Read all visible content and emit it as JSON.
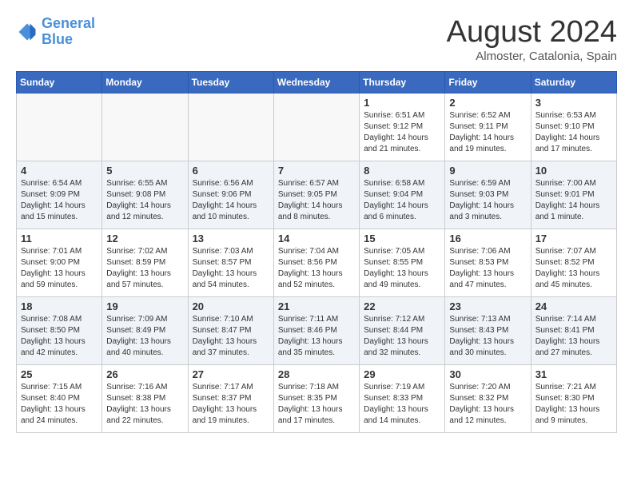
{
  "header": {
    "logo": {
      "line1": "General",
      "line2": "Blue"
    },
    "title": "August 2024",
    "location": "Almoster, Catalonia, Spain"
  },
  "weekdays": [
    "Sunday",
    "Monday",
    "Tuesday",
    "Wednesday",
    "Thursday",
    "Friday",
    "Saturday"
  ],
  "weeks": [
    [
      {
        "day": "",
        "text": ""
      },
      {
        "day": "",
        "text": ""
      },
      {
        "day": "",
        "text": ""
      },
      {
        "day": "",
        "text": ""
      },
      {
        "day": "1",
        "text": "Sunrise: 6:51 AM\nSunset: 9:12 PM\nDaylight: 14 hours\nand 21 minutes."
      },
      {
        "day": "2",
        "text": "Sunrise: 6:52 AM\nSunset: 9:11 PM\nDaylight: 14 hours\nand 19 minutes."
      },
      {
        "day": "3",
        "text": "Sunrise: 6:53 AM\nSunset: 9:10 PM\nDaylight: 14 hours\nand 17 minutes."
      }
    ],
    [
      {
        "day": "4",
        "text": "Sunrise: 6:54 AM\nSunset: 9:09 PM\nDaylight: 14 hours\nand 15 minutes."
      },
      {
        "day": "5",
        "text": "Sunrise: 6:55 AM\nSunset: 9:08 PM\nDaylight: 14 hours\nand 12 minutes."
      },
      {
        "day": "6",
        "text": "Sunrise: 6:56 AM\nSunset: 9:06 PM\nDaylight: 14 hours\nand 10 minutes."
      },
      {
        "day": "7",
        "text": "Sunrise: 6:57 AM\nSunset: 9:05 PM\nDaylight: 14 hours\nand 8 minutes."
      },
      {
        "day": "8",
        "text": "Sunrise: 6:58 AM\nSunset: 9:04 PM\nDaylight: 14 hours\nand 6 minutes."
      },
      {
        "day": "9",
        "text": "Sunrise: 6:59 AM\nSunset: 9:03 PM\nDaylight: 14 hours\nand 3 minutes."
      },
      {
        "day": "10",
        "text": "Sunrise: 7:00 AM\nSunset: 9:01 PM\nDaylight: 14 hours\nand 1 minute."
      }
    ],
    [
      {
        "day": "11",
        "text": "Sunrise: 7:01 AM\nSunset: 9:00 PM\nDaylight: 13 hours\nand 59 minutes."
      },
      {
        "day": "12",
        "text": "Sunrise: 7:02 AM\nSunset: 8:59 PM\nDaylight: 13 hours\nand 57 minutes."
      },
      {
        "day": "13",
        "text": "Sunrise: 7:03 AM\nSunset: 8:57 PM\nDaylight: 13 hours\nand 54 minutes."
      },
      {
        "day": "14",
        "text": "Sunrise: 7:04 AM\nSunset: 8:56 PM\nDaylight: 13 hours\nand 52 minutes."
      },
      {
        "day": "15",
        "text": "Sunrise: 7:05 AM\nSunset: 8:55 PM\nDaylight: 13 hours\nand 49 minutes."
      },
      {
        "day": "16",
        "text": "Sunrise: 7:06 AM\nSunset: 8:53 PM\nDaylight: 13 hours\nand 47 minutes."
      },
      {
        "day": "17",
        "text": "Sunrise: 7:07 AM\nSunset: 8:52 PM\nDaylight: 13 hours\nand 45 minutes."
      }
    ],
    [
      {
        "day": "18",
        "text": "Sunrise: 7:08 AM\nSunset: 8:50 PM\nDaylight: 13 hours\nand 42 minutes."
      },
      {
        "day": "19",
        "text": "Sunrise: 7:09 AM\nSunset: 8:49 PM\nDaylight: 13 hours\nand 40 minutes."
      },
      {
        "day": "20",
        "text": "Sunrise: 7:10 AM\nSunset: 8:47 PM\nDaylight: 13 hours\nand 37 minutes."
      },
      {
        "day": "21",
        "text": "Sunrise: 7:11 AM\nSunset: 8:46 PM\nDaylight: 13 hours\nand 35 minutes."
      },
      {
        "day": "22",
        "text": "Sunrise: 7:12 AM\nSunset: 8:44 PM\nDaylight: 13 hours\nand 32 minutes."
      },
      {
        "day": "23",
        "text": "Sunrise: 7:13 AM\nSunset: 8:43 PM\nDaylight: 13 hours\nand 30 minutes."
      },
      {
        "day": "24",
        "text": "Sunrise: 7:14 AM\nSunset: 8:41 PM\nDaylight: 13 hours\nand 27 minutes."
      }
    ],
    [
      {
        "day": "25",
        "text": "Sunrise: 7:15 AM\nSunset: 8:40 PM\nDaylight: 13 hours\nand 24 minutes."
      },
      {
        "day": "26",
        "text": "Sunrise: 7:16 AM\nSunset: 8:38 PM\nDaylight: 13 hours\nand 22 minutes."
      },
      {
        "day": "27",
        "text": "Sunrise: 7:17 AM\nSunset: 8:37 PM\nDaylight: 13 hours\nand 19 minutes."
      },
      {
        "day": "28",
        "text": "Sunrise: 7:18 AM\nSunset: 8:35 PM\nDaylight: 13 hours\nand 17 minutes."
      },
      {
        "day": "29",
        "text": "Sunrise: 7:19 AM\nSunset: 8:33 PM\nDaylight: 13 hours\nand 14 minutes."
      },
      {
        "day": "30",
        "text": "Sunrise: 7:20 AM\nSunset: 8:32 PM\nDaylight: 13 hours\nand 12 minutes."
      },
      {
        "day": "31",
        "text": "Sunrise: 7:21 AM\nSunset: 8:30 PM\nDaylight: 13 hours\nand 9 minutes."
      }
    ]
  ]
}
